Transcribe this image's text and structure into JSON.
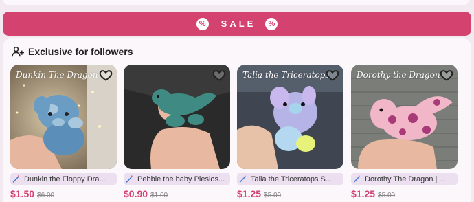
{
  "sale": {
    "label": "SALE",
    "icon": "percent-badge-icon",
    "color": "#d4426f"
  },
  "section": {
    "title": "Exclusive for followers",
    "icon": "user-plus-icon"
  },
  "products": [
    {
      "caption": "Dunkin The Dragon",
      "title": "Dunkin the Floppy Dra...",
      "price": "$1.50",
      "old_price": "$6.00"
    },
    {
      "caption": "",
      "title": "Pebble the baby Plesios...",
      "price": "$0.90",
      "old_price": "$1.00"
    },
    {
      "caption": "Talia the Triceratops",
      "title": "Talia the Triceratops S...",
      "price": "$1.25",
      "old_price": "$5.00"
    },
    {
      "caption": "Dorothy the Dragon",
      "title": "Dorothy The Dragon | ...",
      "price": "$1.25",
      "old_price": "$5.00"
    }
  ]
}
